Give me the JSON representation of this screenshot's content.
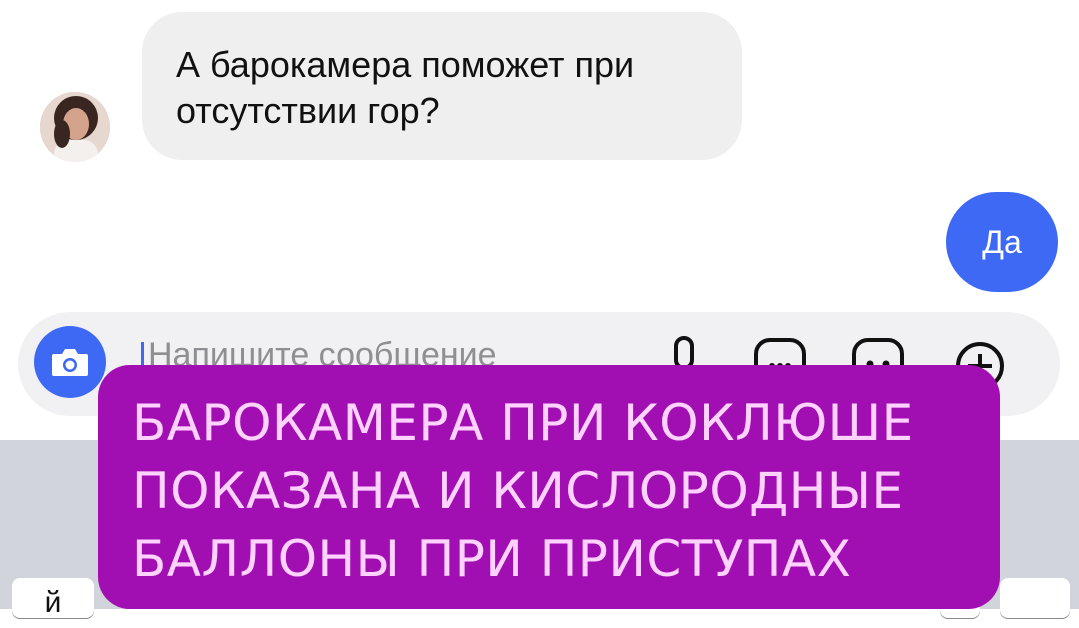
{
  "chat": {
    "incoming": {
      "lines": [
        "А барокамера поможет при",
        "отсутствии гор?"
      ]
    },
    "outgoing": {
      "text": "Да"
    }
  },
  "composer": {
    "placeholder": "Напишите сообщение"
  },
  "keyboard": {
    "visible_key": "й"
  },
  "overlay": {
    "lines": [
      "БАРОКАМЕРА ПРИ КОКЛЮШЕ",
      "ПОКАЗАНА И КИСЛОРОДНЫЕ",
      "БАЛЛОНЫ ПРИ ПРИСТУПАХ"
    ]
  },
  "colors": {
    "accent": "#3e69f5",
    "overlay_bg": "#a10fb2",
    "overlay_text": "#ffd2ff",
    "incoming_bubble": "#efefef"
  },
  "icons": [
    "camera-icon",
    "microphone-icon",
    "sticker-icon",
    "emoji-icon",
    "plus-circle-icon"
  ]
}
